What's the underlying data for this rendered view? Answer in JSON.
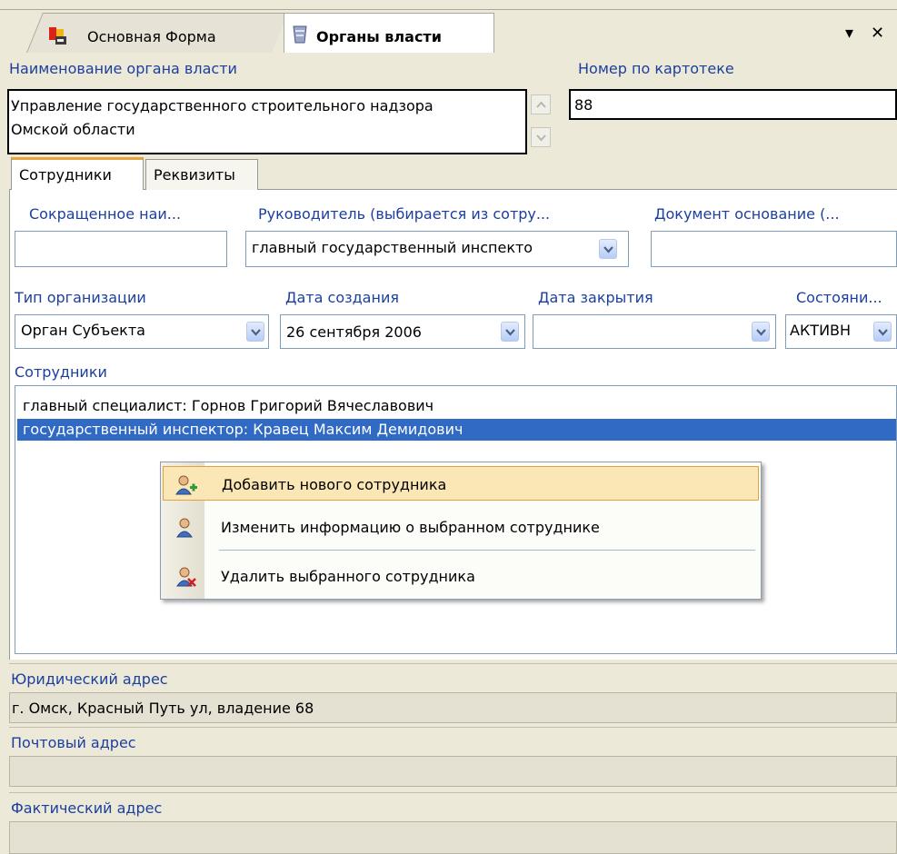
{
  "tabs": {
    "main_form_label": "Основная Форма",
    "authorities_label": "Органы власти",
    "dropdown_arrow": "▾",
    "close": "✕"
  },
  "header": {
    "name_label": "Наименование органа власти",
    "name_value_line1": "Управление государственного строительного надзора",
    "name_value_line2": "Омской области",
    "card_number_label": "Номер по картотеке",
    "card_number_value": "88"
  },
  "inner_tabs": {
    "employees": "Сотрудники",
    "requisites": "Реквизиты"
  },
  "form": {
    "short_name_label": "Сокращенное наи...",
    "short_name_value": "",
    "head_label": "Руководитель (выбирается из сотру...",
    "head_value": "главный государственный инспекто",
    "doc_basis_label": "Документ основание (...",
    "doc_basis_value": "",
    "org_type_label": "Тип организации",
    "org_type_value": "Орган Субъекта",
    "created_label": "Дата создания",
    "created_value": "26 сентября 2006",
    "closed_label": "Дата закрытия",
    "closed_value": "",
    "state_label": "Состояни...",
    "state_value": "АКТИВН"
  },
  "employees": {
    "section_label": "Сотрудники",
    "rows": [
      "главный специалист:  Горнов Григорий Вячеславович",
      "государственный инспектор:  Кравец Максим Демидович"
    ]
  },
  "context_menu": {
    "add": "Добавить нового сотрудника",
    "edit": "Изменить информацию о выбранном сотруднике",
    "delete": "Удалить выбранного сотрудника"
  },
  "addresses": {
    "legal_label": "Юридический адрес",
    "legal_value": "г. Омск, Красный Путь ул, владение 68",
    "postal_label": "Почтовый адрес",
    "postal_value": "",
    "actual_label": "Фактический адрес",
    "actual_value": ""
  },
  "colors": {
    "label_blue": "#1c3f9e",
    "selection": "#316ac5",
    "menu_highlight": "#fbe7b5",
    "tab_accent": "#e8a33a"
  }
}
